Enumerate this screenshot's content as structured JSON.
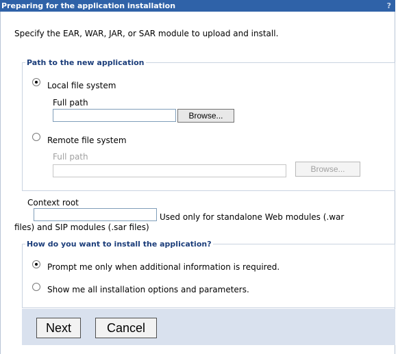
{
  "window": {
    "title": "Preparing for the application installation",
    "help_label": "?"
  },
  "intro_text": "Specify the EAR, WAR, JAR, or SAR module to upload and install.",
  "path_section": {
    "legend": "Path to the new application",
    "local": {
      "label": "Local file system",
      "selected": true,
      "full_path_label": "Full path",
      "full_path_value": "",
      "browse_label": "Browse..."
    },
    "remote": {
      "label": "Remote file system",
      "selected": false,
      "full_path_label": "Full path",
      "full_path_value": "",
      "browse_label": "Browse..."
    }
  },
  "context_root": {
    "label": "Context root",
    "value": "",
    "hint_line1": "Used only for standalone Web modules (.war",
    "hint_line2": "files) and SIP modules (.sar files)"
  },
  "install_section": {
    "legend": "How do you want to install the application?",
    "options": [
      {
        "label": "Prompt me only when additional information is required.",
        "selected": true
      },
      {
        "label": "Show me all installation options and parameters.",
        "selected": false
      }
    ]
  },
  "footer": {
    "next_label": "Next",
    "cancel_label": "Cancel"
  }
}
